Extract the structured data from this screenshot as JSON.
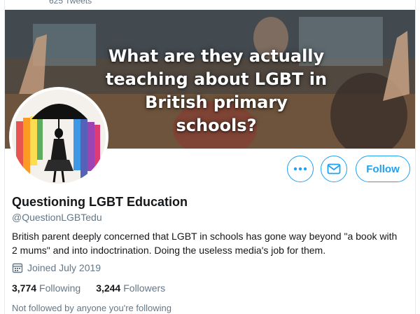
{
  "header": {
    "tweet_count": "625 Tweets"
  },
  "banner": {
    "headline_line1": "What are they actually",
    "headline_line2": "teaching about LGBT in",
    "headline_line3": "British primary schools?"
  },
  "actions": {
    "more_icon": "more-dots-icon",
    "message_icon": "envelope-icon",
    "follow_label": "Follow",
    "accent_color": "#1da1f2"
  },
  "profile": {
    "name": "Questioning LGBT Education",
    "handle": "@QuestionLGBTedu",
    "bio": "British parent deeply concerned that LGBT in schools has gone way beyond \"a book with 2 mums\" and into indoctrination. Doing the useless media's job for them.",
    "joined": "Joined July 2019",
    "following_count": "3,774",
    "following_label": "Following",
    "followers_count": "3,244",
    "followers_label": "Followers",
    "not_followed": "Not followed by anyone you're following"
  }
}
